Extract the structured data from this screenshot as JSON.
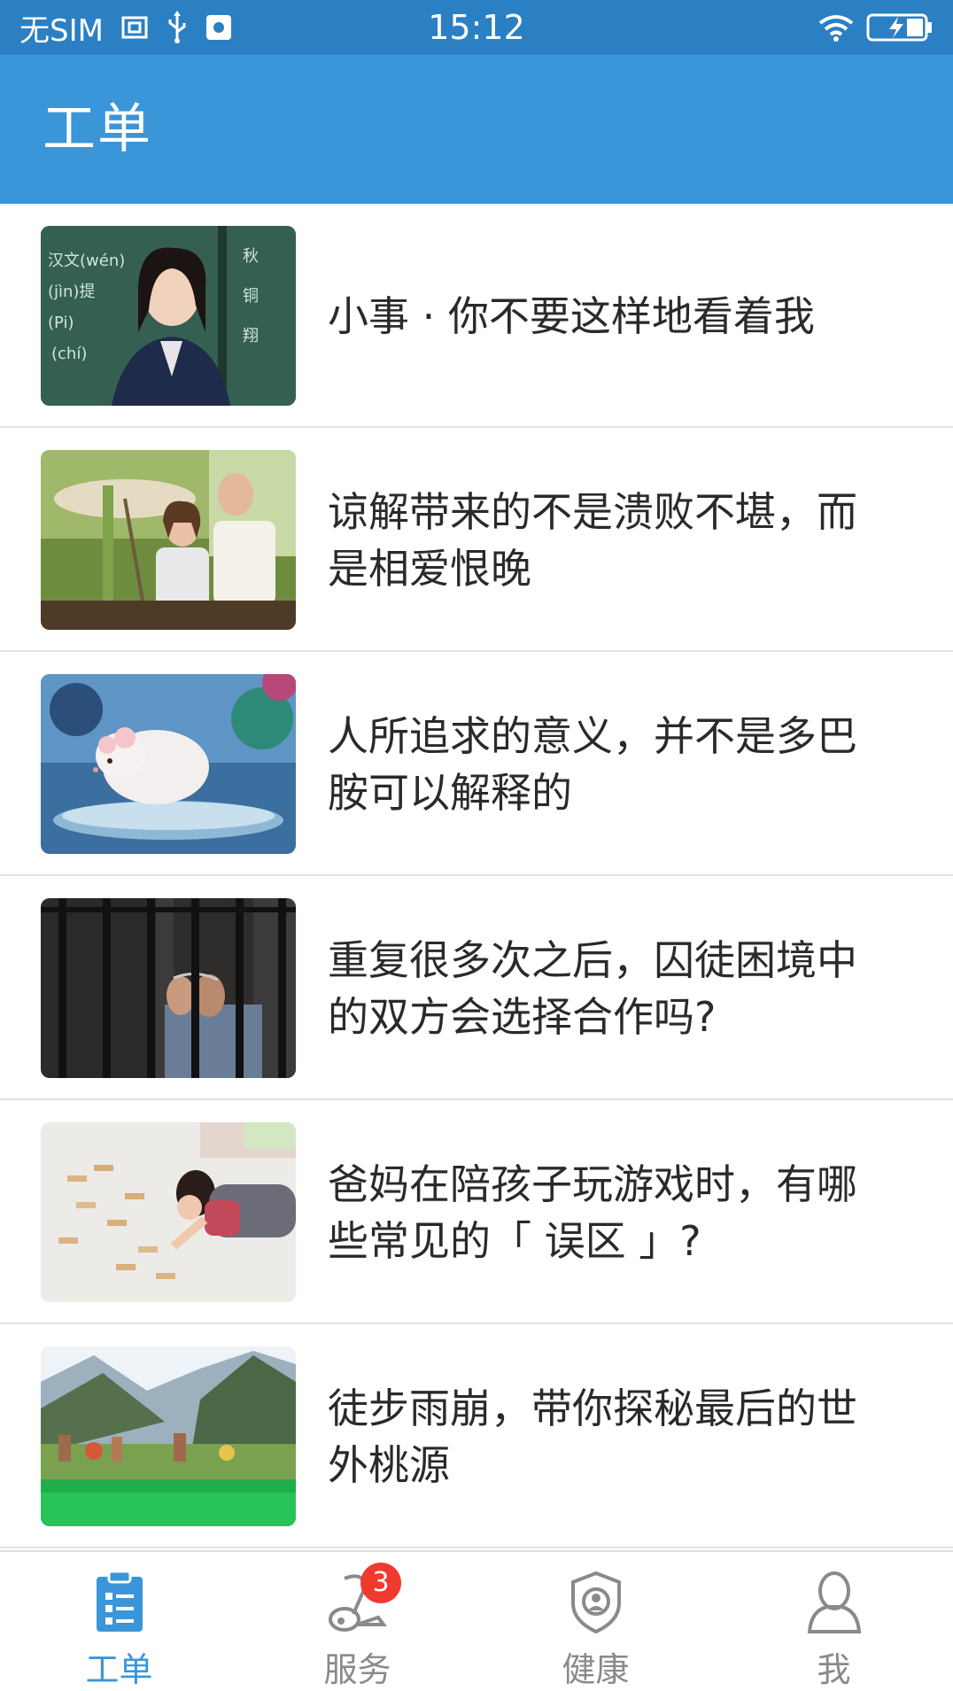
{
  "status_bar": {
    "carrier": "无SIM",
    "time": "15:12"
  },
  "header": {
    "title": "工单"
  },
  "articles": [
    {
      "title": "小事 · 你不要这样地看着我"
    },
    {
      "title": "谅解带来的不是溃败不堪，而是相爱恨晚"
    },
    {
      "title": "人所追求的意义，并不是多巴胺可以解释的"
    },
    {
      "title": "重复很多次之后，囚徒困境中的双方会选择合作吗?"
    },
    {
      "title": "爸妈在陪孩子玩游戏时，有哪些常见的「 误区 」?"
    },
    {
      "title": "徒步雨崩，带你探秘最后的世外桃源"
    }
  ],
  "tabs": [
    {
      "label": "工单",
      "icon": "clipboard-icon",
      "active": true
    },
    {
      "label": "服务",
      "icon": "vacuum-icon",
      "badge": "3"
    },
    {
      "label": "健康",
      "icon": "shield-person-icon"
    },
    {
      "label": "我",
      "icon": "person-icon"
    }
  ],
  "colors": {
    "status_bar": "#2b7fc3",
    "app_bar": "#3a96d9",
    "active_tab": "#3a96d9",
    "inactive_tab": "#8a8a8a",
    "badge": "#f03a2e"
  }
}
